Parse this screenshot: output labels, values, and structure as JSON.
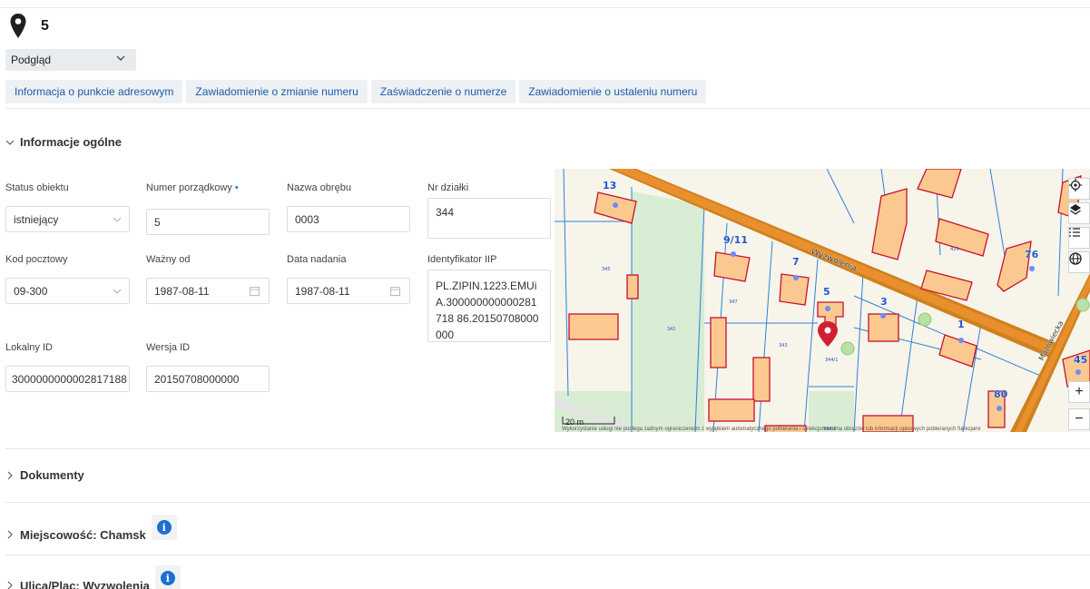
{
  "header": {
    "number": "5"
  },
  "view_select": {
    "value": "Podgląd"
  },
  "actions": [
    "Informacja o punkcie adresowym",
    "Zawiadomienie o zmianie numeru",
    "Zaświadczenie o numerze",
    "Zawiadomienie o ustaleniu numeru"
  ],
  "sections": {
    "general": "Informacje ogólne",
    "documents": "Dokumenty",
    "locality": "Miejscowość: Chamsk",
    "street": "Ulica/Plac: Wyzwolenia"
  },
  "fields": {
    "status": {
      "label": "Status obiektu",
      "value": "istniejący"
    },
    "number": {
      "label": "Numer porządkowy",
      "required_mark": "•",
      "value": "5"
    },
    "precinct": {
      "label": "Nazwa obrębu",
      "value": "0003"
    },
    "plot": {
      "label": "Nr działki",
      "value": "344"
    },
    "postal": {
      "label": "Kod pocztowy",
      "value": "09-300"
    },
    "valid_from": {
      "label": "Ważny od",
      "value": "1987-08-11"
    },
    "assigned": {
      "label": "Data nadania",
      "value": "1987-08-11"
    },
    "iip": {
      "label": "Identyfikator IIP",
      "value": "PL.ZIPIN.1223.EMUiA.300000000000281718 86.20150708000000"
    },
    "local_id": {
      "label": "Lokalny ID",
      "value": "3000000000002817188"
    },
    "version": {
      "label": "Wersja ID",
      "value": "20150708000000"
    }
  },
  "map": {
    "street_labels": [
      "Wyzwolenia",
      "Mazowiecka"
    ],
    "address_numbers": [
      "13",
      "9/11",
      "7",
      "5",
      "3",
      "1",
      "76",
      "45",
      "80"
    ],
    "parcel_labels": [
      "347",
      "343",
      "344/1",
      "344/2",
      "345",
      "341",
      "425"
    ],
    "scale": "20 m",
    "attribution": "Wykorzystanie usługi nie podlega żadnym ograniczeniom z wyjątkiem automatycznego pobierania i selekcjonowania obrazów lub informacji opisowych pobieranych funkcjami",
    "tools": [
      "locate-icon",
      "layers-icon",
      "legend-icon",
      "globe-icon"
    ],
    "zoom_in": "+",
    "zoom_out": "−",
    "colors": {
      "building_fill": "#fbc98f",
      "building_stroke": "#c8102e",
      "road": "#e8902d",
      "green": "#d9ecd4",
      "parcel_line": "#2b82d9",
      "label": "#2255cc"
    }
  }
}
